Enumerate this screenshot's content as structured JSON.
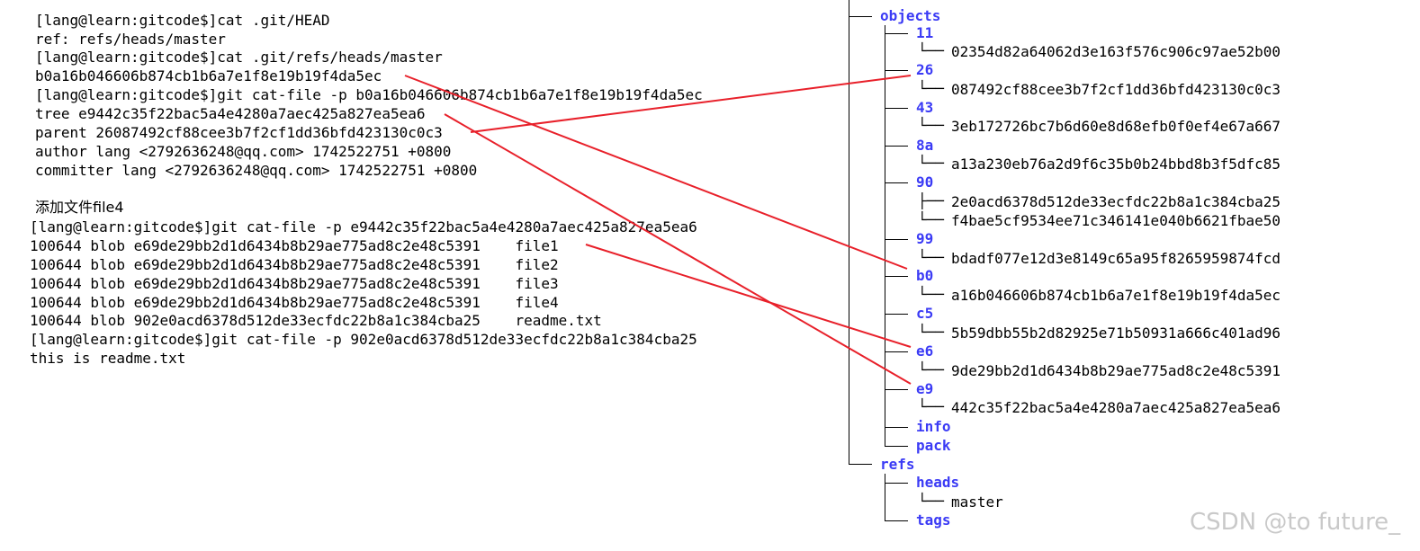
{
  "terminal": {
    "lines": [
      "[lang@learn:gitcode$]cat .git/HEAD",
      "ref: refs/heads/master",
      "[lang@learn:gitcode$]cat .git/refs/heads/master",
      "b0a16b046606b874cb1b6a7e1f8e19b19f4da5ec",
      "[lang@learn:gitcode$]git cat-file -p b0a16b046606b874cb1b6a7e1f8e19b19f4da5ec",
      "tree e9442c35f22bac5a4e4280a7aec425a827ea5ea6",
      "parent 26087492cf88cee3b7f2cf1dd36bfd423130c0c3",
      "author lang <2792636248@qq.com> 1742522751 +0800",
      "committer lang <2792636248@qq.com> 1742522751 +0800",
      "添加文件file4",
      "[lang@learn:gitcode$]git cat-file -p e9442c35f22bac5a4e4280a7aec425a827ea5ea6",
      "100644 blob e69de29bb2d1d6434b8b29ae775ad8c2e48c5391    file1",
      "100644 blob e69de29bb2d1d6434b8b29ae775ad8c2e48c5391    file2",
      "100644 blob e69de29bb2d1d6434b8b29ae775ad8c2e48c5391    file3",
      "100644 blob e69de29bb2d1d6434b8b29ae775ad8c2e48c5391    file4",
      "100644 blob 902e0acd6378d512de33ecfdc22b8a1c384cba25    readme.txt",
      "[lang@learn:gitcode$]git cat-file -p 902e0acd6378d512de33ecfdc22b8a1c384cba25",
      "this is readme.txt"
    ]
  },
  "tree": {
    "objects_label": "objects",
    "dirs": [
      {
        "name": "11",
        "files": [
          "02354d82a64062d3e163f576c906c97ae52b00"
        ]
      },
      {
        "name": "26",
        "files": [
          "087492cf88cee3b7f2cf1dd36bfd423130c0c3"
        ]
      },
      {
        "name": "43",
        "files": [
          "3eb172726bc7b6d60e8d68efb0f0ef4e67a667"
        ]
      },
      {
        "name": "8a",
        "files": [
          "a13a230eb76a2d9f6c35b0b24bbd8b3f5dfc85"
        ]
      },
      {
        "name": "90",
        "files": [
          "2e0acd6378d512de33ecfdc22b8a1c384cba25",
          "f4bae5cf9534ee71c346141e040b6621fbae50"
        ]
      },
      {
        "name": "99",
        "files": [
          "bdadf077e12d3e8149c65a95f8265959874fcd"
        ]
      },
      {
        "name": "b0",
        "files": [
          "a16b046606b874cb1b6a7e1f8e19b19f4da5ec"
        ]
      },
      {
        "name": "c5",
        "files": [
          "5b59dbb55b2d82925e71b50931a666c401ad96"
        ]
      },
      {
        "name": "e6",
        "files": [
          "9de29bb2d1d6434b8b29ae775ad8c2e48c5391"
        ]
      },
      {
        "name": "e9",
        "files": [
          "442c35f22bac5a4e4280a7aec425a827ea5ea6"
        ]
      }
    ],
    "info_label": "info",
    "pack_label": "pack",
    "refs_label": "refs",
    "heads_label": "heads",
    "master_label": "master",
    "tags_label": "tags"
  },
  "colors": {
    "arrow": "#e8202a",
    "directory": "#3b3bf5",
    "text": "#000000"
  },
  "watermark": "CSDN @to future_"
}
